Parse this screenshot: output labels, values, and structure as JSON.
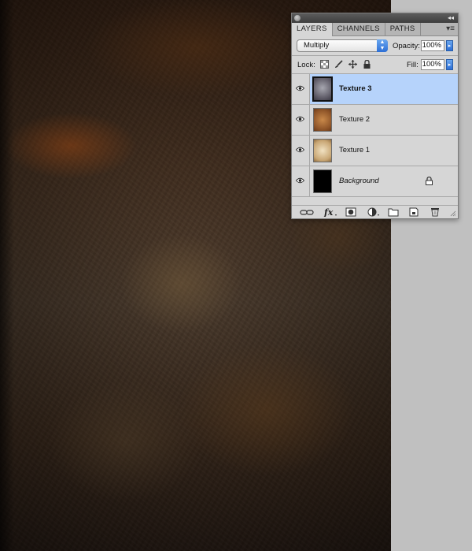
{
  "panel": {
    "tabs": [
      {
        "label": "LAYERS"
      },
      {
        "label": "CHANNELS"
      },
      {
        "label": "PATHS"
      }
    ],
    "blend_mode": "Multiply",
    "opacity_label": "Opacity:",
    "opacity_value": "100%",
    "lock_label": "Lock:",
    "fill_label": "Fill:",
    "fill_value": "100%",
    "layers": [
      {
        "name": "Texture 3",
        "selected": true,
        "visible": true
      },
      {
        "name": "Texture 2",
        "selected": false,
        "visible": true
      },
      {
        "name": "Texture 1",
        "selected": false,
        "visible": true
      },
      {
        "name": "Background",
        "selected": false,
        "visible": true,
        "locked": true
      }
    ],
    "icons": [
      "close-icon",
      "collapse-icon",
      "panel-menu-icon",
      "blend-mode-arrows-icon",
      "lock-transparent-pixels-icon",
      "lock-image-pixels-icon",
      "lock-position-icon",
      "lock-all-icon",
      "eye-icon",
      "link-layers-icon",
      "fx-icon",
      "add-mask-icon",
      "adjustment-layer-icon",
      "new-group-icon",
      "new-layer-icon",
      "trash-icon"
    ]
  },
  "colors": {
    "selection": "#b6d3fb",
    "panel_bg": "#d6d6d6",
    "workspace_bg": "#c0c0c0",
    "accent_blue": "#2d6fd6"
  }
}
